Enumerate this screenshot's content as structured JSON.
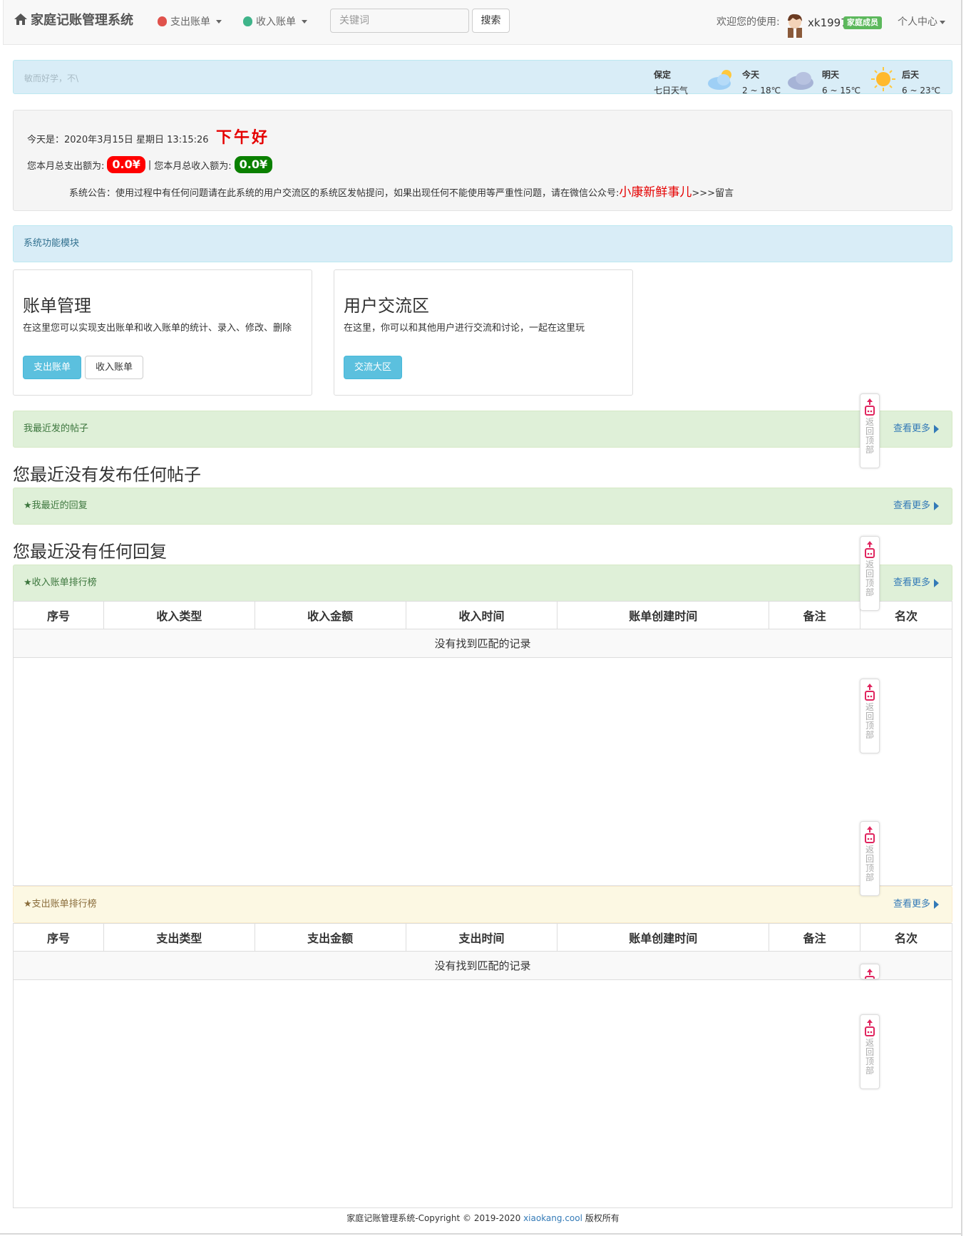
{
  "navbar": {
    "brand": "家庭记账管理系统",
    "expense_menu": "支出账单",
    "income_menu": "收入账单",
    "search_placeholder": "关键词",
    "search_button": "搜索",
    "welcome": "欢迎您的使用:",
    "username": "xk1997",
    "role_badge": "家庭成员",
    "personal_center": "个人中心"
  },
  "weather": {
    "marquee": "敏而好学，不\\",
    "city": "保定",
    "subtitle": "七日天气",
    "days": [
      {
        "label": "今天",
        "range": "2 ~ 18℃",
        "icon": "partly-cloudy-icon"
      },
      {
        "label": "明天",
        "range": "6 ~ 15℃",
        "icon": "cloudy-icon"
      },
      {
        "label": "后天",
        "range": "6 ~ 23℃",
        "icon": "sunny-icon"
      }
    ]
  },
  "info": {
    "today_label": "今天是：2020年3月15日 星期日 13:15:26",
    "greeting": "下午好",
    "expense_total_label": "您本月总支出额为:",
    "expense_total": "0.0¥",
    "separator": "|",
    "income_total_label": "您本月总收入额为:",
    "income_total": "0.0¥",
    "notice": "系统公告：使用过程中有任何问题请在此系统的用户交流区的系统区发帖提问，如果出现任何不能使用等严重性问题，请在微信公众号:",
    "notice_accent": "小康新鲜事儿",
    "notice_tail": ">>>留言"
  },
  "modules": {
    "heading": "系统功能模块",
    "cards": [
      {
        "title": "账单管理",
        "desc": "在这里您可以实现支出账单和收入账单的统计、录入、修改、删除",
        "btn1": "支出账单",
        "btn2": "收入账单"
      },
      {
        "title": "用户交流区",
        "desc": "在这里，你可以和其他用户进行交流和讨论，一起在这里玩",
        "btn1": "交流大区"
      }
    ]
  },
  "posts": {
    "heading": "我最近发的帖子",
    "more": "查看更多",
    "empty": "您最近没有发布任何帖子"
  },
  "replies": {
    "heading": "★我最近的回复",
    "more": "查看更多",
    "empty": "您最近没有任何回复"
  },
  "income_rank": {
    "heading": "★收入账单排行榜",
    "more": "查看更多",
    "columns": [
      "序号",
      "收入类型",
      "收入金额",
      "收入时间",
      "账单创建时间",
      "备注",
      "名次"
    ],
    "empty": "没有找到匹配的记录"
  },
  "expense_rank": {
    "heading": "★支出账单排行榜",
    "more": "查看更多",
    "columns": [
      "序号",
      "支出类型",
      "支出金额",
      "支出时间",
      "账单创建时间",
      "备注",
      "名次"
    ],
    "empty": "没有找到匹配的记录"
  },
  "back_to_top": "返回顶部",
  "footer": {
    "text": "家庭记账管理系统-Copyright © 2019-2020 ",
    "link": "xiaokang.cool",
    "tail": " 版权所有"
  },
  "colors": {
    "expense_pill": "#ff0000",
    "income_pill": "#0a8000",
    "greeting": "#e50000",
    "role_badge": "#5cb85c"
  }
}
